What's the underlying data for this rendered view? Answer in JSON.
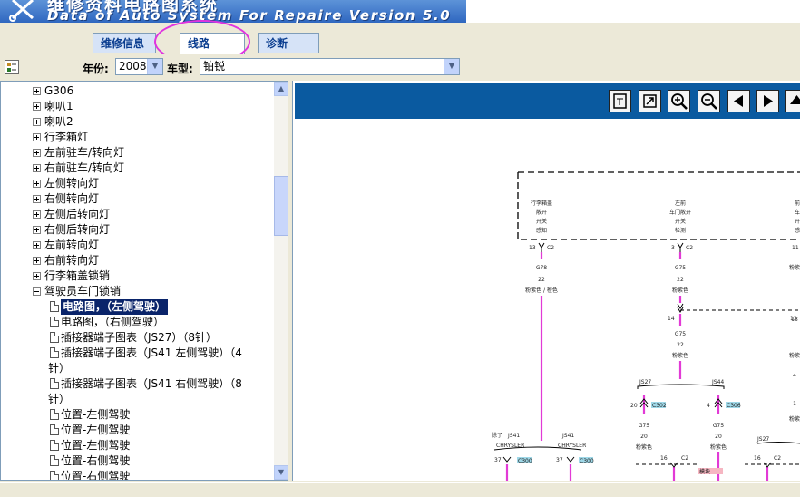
{
  "banner": {
    "title": "维修资料电路图系统",
    "subtitle": "Data of Auto System For Repaire Version 5.0"
  },
  "tabs": [
    {
      "label": "维修信息"
    },
    {
      "label": "线路"
    },
    {
      "label": "诊断"
    }
  ],
  "toolbar": {
    "year_label": "年份:",
    "year_value": "2008",
    "model_label": "车型:",
    "model_value": "铂锐"
  },
  "tree": {
    "nodes": [
      {
        "label": "G306"
      },
      {
        "label": "喇叭1"
      },
      {
        "label": "喇叭2"
      },
      {
        "label": "行李箱灯"
      },
      {
        "label": "左前驻车/转向灯"
      },
      {
        "label": "右前驻车/转向灯"
      },
      {
        "label": "左侧转向灯"
      },
      {
        "label": "右侧转向灯"
      },
      {
        "label": "左侧后转向灯"
      },
      {
        "label": "右侧后转向灯"
      },
      {
        "label": "左前转向灯"
      },
      {
        "label": "右前转向灯"
      },
      {
        "label": "行李箱盖锁销"
      },
      {
        "label": "驾驶员车门锁销"
      }
    ],
    "children": [
      {
        "line1": "电路图，（左侧驾驶）",
        "line2": ""
      },
      {
        "line1": "电路图，（右侧驾驶）",
        "line2": ""
      },
      {
        "line1": "插接器端子图表（JS27）（8针）",
        "line2": ""
      },
      {
        "line1": "插接器端子图表（JS41 左侧驾驶）（4",
        "line2": "针）"
      },
      {
        "line1": "插接器端子图表（JS41 右侧驾驶）（8",
        "line2": "针）"
      },
      {
        "line1": "位置-左侧驾驶",
        "line2": ""
      },
      {
        "line1": "位置-左侧驾驶",
        "line2": ""
      },
      {
        "line1": "位置-左侧驾驶",
        "line2": ""
      },
      {
        "line1": "位置-右侧驾驶",
        "line2": ""
      },
      {
        "line1": "位置-右侧驾驶",
        "line2": ""
      }
    ]
  },
  "viewer_tools": [
    {
      "name": "fit-page-icon"
    },
    {
      "name": "fit-width-icon"
    },
    {
      "name": "zoom-in-icon"
    },
    {
      "name": "zoom-out-icon"
    },
    {
      "name": "arrow-left-icon"
    },
    {
      "name": "arrow-right-icon"
    },
    {
      "name": "arrow-up-icon"
    }
  ],
  "diagram": {
    "boxes": [
      {
        "l1": "行李箱盖",
        "l2": "敞开",
        "l3": "开关",
        "l4": "感知"
      },
      {
        "l1": "左前",
        "l2": "车门敞开",
        "l3": "开关",
        "l4": "检测"
      },
      {
        "l1": "前",
        "l2": "车",
        "l3": "开",
        "l4": "感"
      }
    ],
    "pins": {
      "p13": "13",
      "p3": "3",
      "p11": "11",
      "c2": "C2",
      "p14": "14",
      "p13b": "13",
      "p20": "20",
      "p4": "4",
      "p37": "37",
      "p16": "16"
    },
    "wires": {
      "g78": "G78",
      "g75": "G75",
      "g75b": "G75",
      "g75c": "G75",
      "g75d": "G75",
      "gauge22": "22",
      "gauge22b": "22",
      "gauge22c": "22",
      "gauge20": "20",
      "gauge20b": "20",
      "pink_white": "粉紫色 / 橙色",
      "pink_purple": "粉紫色",
      "pink_purple_b": "粉紫色",
      "pink_purple_c": "粉紫色",
      "pink_purple_d": "粉紫色",
      "pink_purple_e": "粉紫色",
      "pink_purple_f": "粉紫色",
      "pink_purple_g": "粉紫色",
      "num_13": "13",
      "num_4": "4",
      "num_1": "1"
    },
    "splices": {
      "js27": "JS27",
      "js44": "JS44",
      "js41": "JS41",
      "js27b": "JS27",
      "except": "除了",
      "chrysler": "CHRYSLER",
      "chrysler_b": "CHRYSLER",
      "c302": "C302",
      "c306": "C306",
      "c300": "C300",
      "c300b": "C300",
      "module": "模块"
    }
  }
}
